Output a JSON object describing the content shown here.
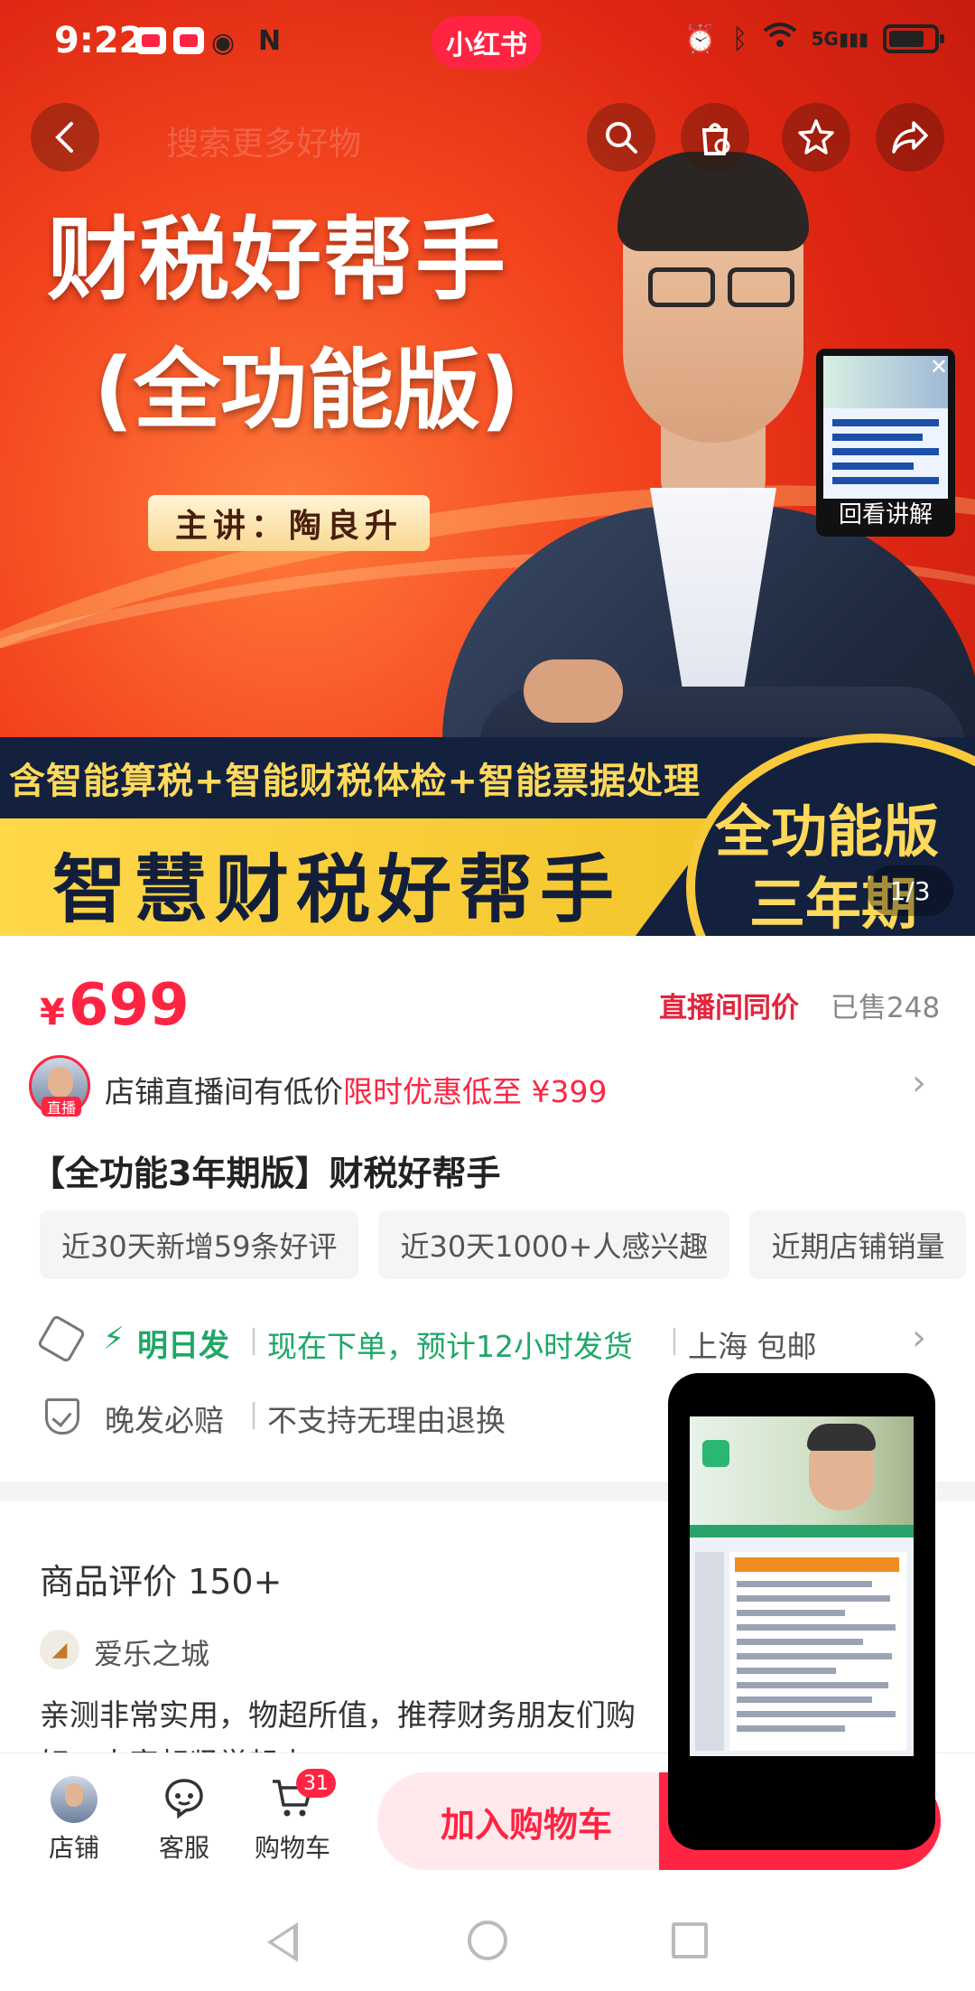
{
  "status_bar": {
    "time": "9:22",
    "brand": "小红书",
    "network": "5G"
  },
  "hero": {
    "title": "财税好帮手",
    "subtitle": "(全功能版)",
    "presenter": "主讲：陶良升",
    "banner_line1": "含智能算税+智能财税体检+智能票据处理",
    "banner_line2": "智慧财税好帮手",
    "version_line1": "全功能版",
    "version_line2": "三年期",
    "page_counter": "1/3",
    "search_ghost": "搜索更多好物",
    "live_thumb_label": "回看讲解"
  },
  "product": {
    "price_symbol": "¥",
    "price": "699",
    "same_price_label": "直播间同价",
    "sold": "已售248",
    "live_badge": "直播",
    "promo_text": "店铺直播间有低价",
    "promo_highlight": "限时优惠低至 ¥399",
    "title": "【全功能3年期版】财税好帮手",
    "tags": [
      "近30天新增59条好评",
      "近30天1000+人感兴趣",
      "近期店铺销量"
    ],
    "ship_tomorrow": "明日发",
    "ship_eta": "现在下单，预计12小时发货",
    "ship_location": "上海 包邮",
    "late_compensation": "晚发必赔",
    "no_return": "不支持无理由退换"
  },
  "reviews": {
    "title": "商品评价 150+",
    "reviewer": "爱乐之城",
    "text": "亲测非常实用，物超所值，推荐财务朋友们购",
    "text2": "好，大家赶紧学起来"
  },
  "bottom_bar": {
    "store_label": "店铺",
    "service_label": "客服",
    "cart_label": "购物车",
    "cart_count": "31",
    "add_to_cart": "加入购物车"
  },
  "colors": {
    "accent": "#ff2442",
    "ship_green": "#1fa767"
  }
}
